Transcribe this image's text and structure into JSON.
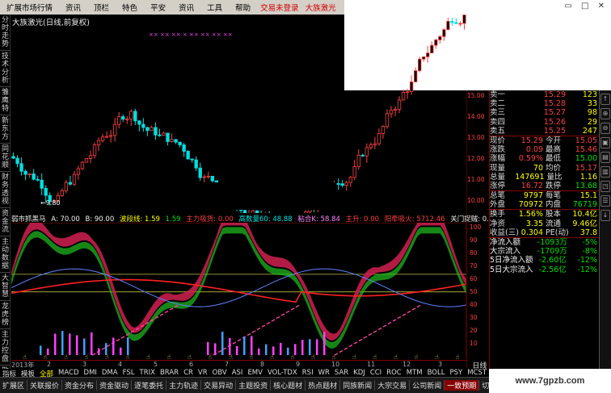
{
  "menu": {
    "items": [
      "扩展市场行情",
      "资讯",
      "顶栏",
      "特色",
      "平安",
      "资讯",
      "工具",
      "帮助"
    ],
    "alert1": "交易未登录",
    "alert2": "大族激光",
    "window_controls": "▭ □ ✕"
  },
  "sidebar": {
    "tabs": [
      "分时走势",
      "技术分析",
      "雏鹰特",
      "新东方",
      "同花顺",
      "财务透视",
      "资金流",
      "主动数据",
      "大智慧",
      "龙虎榜",
      "主力控盘",
      "散户"
    ]
  },
  "chart": {
    "title": "大族激光(日线,前复权)",
    "low_label": "←9.80",
    "marker_row": "××         ××    ××    ×    ××    ××    ××    ××",
    "y_ticks": [
      "15.00",
      "14.00",
      "13.00",
      "12.00",
      "11.00",
      "10.00"
    ]
  },
  "indicator": {
    "name": "弱市抓黑马",
    "a": "A: 70.00",
    "b": "B: 90.00",
    "line1": "波段线: 1.59",
    "line1b": "1.59",
    "line2": "主力吸货: 0.00",
    "line3": "高数量60: 48.88",
    "line4": "粘合K: 58.84",
    "line5": "主升: 0.00",
    "line6": "阳牵吸火: 5712.46",
    "line7": "关门捉贼: 0.00",
    "y_ticks": [
      "100",
      "90",
      "80",
      "70",
      "60",
      "50",
      "40",
      "30",
      "20",
      "10"
    ]
  },
  "dates": [
    "2013年",
    "2",
    "3",
    "4",
    "5",
    "6",
    "7",
    "8",
    "9",
    "10",
    "11",
    "12",
    "3"
  ],
  "period": "日线",
  "quote": {
    "sell": [
      {
        "l": "卖一",
        "p": "15.29",
        "v": "123"
      },
      {
        "l": "卖二",
        "p": "15.28",
        "v": "33"
      },
      {
        "l": "卖三",
        "p": "15.27",
        "v": "98"
      },
      {
        "l": "卖四",
        "p": "15.26",
        "v": "29"
      },
      {
        "l": "卖五",
        "p": "15.25",
        "v": "247"
      }
    ],
    "r1": [
      [
        "现价",
        "15.29",
        "今开",
        "15.05"
      ],
      [
        "涨跌",
        "0.09",
        "最高",
        "15.46"
      ],
      [
        "涨幅",
        "0.59%",
        "最低",
        "15.00"
      ],
      [
        "现量",
        "70",
        "均价",
        "15.17"
      ],
      [
        "总量",
        "147691",
        "量比",
        "1.16"
      ],
      [
        "涨停",
        "16.72",
        "跌停",
        "13.68"
      ]
    ],
    "r2": [
      [
        "总笔",
        "9797",
        "每笔",
        "15.1"
      ],
      [
        "外盘",
        "70972",
        "内盘",
        "76719"
      ]
    ],
    "r3": [
      [
        "换手",
        "1.56%",
        "股本",
        "10.4亿"
      ],
      [
        "净资",
        "3.35",
        "流通",
        "9.46亿"
      ],
      [
        "收益(三)",
        "0.304",
        "PE(动)",
        "37.8"
      ]
    ],
    "flow": [
      [
        "净流入额",
        "-1093万",
        "-5%"
      ],
      [
        "大宗流入",
        "-1709万",
        "-8%"
      ],
      [
        "5日净流入额",
        "-2.60亿",
        "-12%"
      ],
      [
        "5日大宗流入",
        "-2.56亿",
        "-12%"
      ]
    ]
  },
  "right_scroll": [
    "↑",
    "⊕",
    "⊖",
    "▣",
    "▤",
    "▥",
    "◳",
    "☰",
    "↓"
  ],
  "tabs_row1": [
    "指标",
    "模板",
    "全部",
    "MACD",
    "DMI",
    "DMA",
    "FSL",
    "TRIX",
    "BRAR",
    "CR",
    "VR",
    "OBV",
    "ASI",
    "EMV",
    "VOL-TDX",
    "RSI",
    "WR",
    "SAR",
    "KDJ",
    "CCI",
    "ROC",
    "MTM",
    "BOLL",
    "PSY",
    "MCST"
  ],
  "tabs_row2": [
    "扩展区",
    "关联报价",
    "资金分布",
    "资金驱动",
    "逐笔委托",
    "主力轨迹",
    "交易异动",
    "主题投资",
    "核心题材",
    "热点题材",
    "同族新闻",
    "大宗交易",
    "公司新闻",
    "一致预期",
    "切换"
  ],
  "watermark": "www.7gpzb.com",
  "colors": {
    "up": "#ff4040",
    "down": "#00e000",
    "bg": "#000000",
    "menu": "#d4d0c8"
  }
}
